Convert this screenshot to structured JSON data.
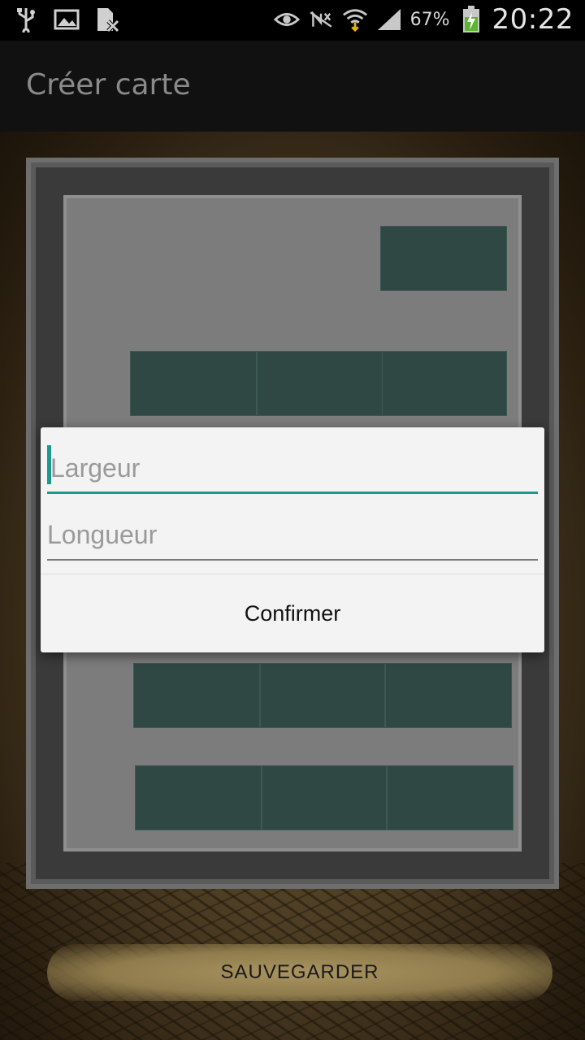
{
  "status_bar": {
    "left_icons": [
      "usb-icon",
      "image-icon",
      "sim-error-icon"
    ],
    "right_icons": [
      "eye-icon",
      "nfc-muted-icon",
      "wifi-icon",
      "signal-icon",
      "battery-charging-icon"
    ],
    "battery": "67%",
    "time": "20:22"
  },
  "action_bar": {
    "title": "Créer carte"
  },
  "dialog": {
    "width_placeholder": "Largeur",
    "length_placeholder": "Longueur",
    "confirm_label": "Confirmer"
  },
  "footer": {
    "save_label": "SAUVEGARDER"
  },
  "colors": {
    "accent": "#1a9a8c",
    "tile": "#2f4843",
    "dialog_bg": "#f3f3f3"
  }
}
